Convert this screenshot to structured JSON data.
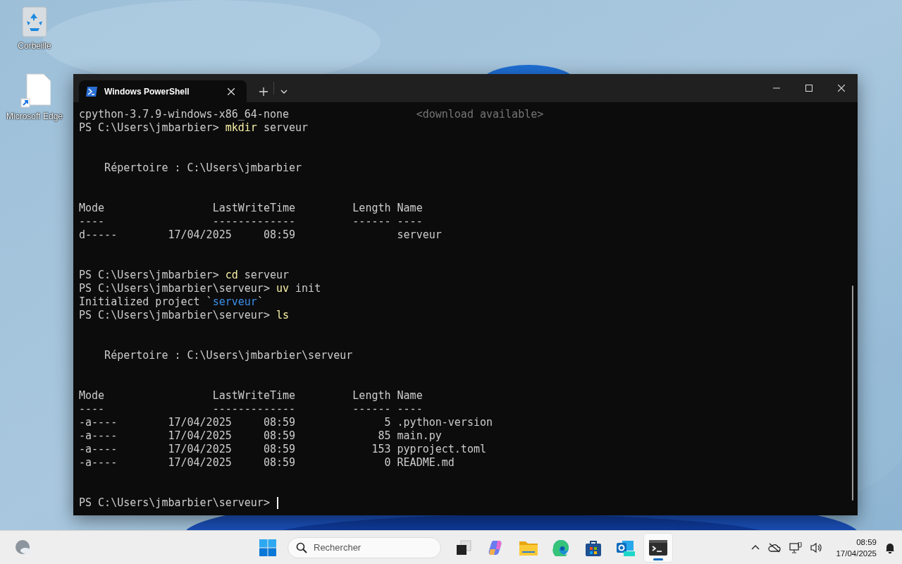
{
  "desktop": {
    "icons": [
      {
        "kind": "recycle",
        "label": "Corbeille"
      },
      {
        "kind": "shortcut",
        "label": "Microsoft Edge"
      }
    ]
  },
  "window": {
    "tabs": [
      {
        "title": "Windows PowerShell",
        "selected": true
      }
    ],
    "lines": [
      {
        "kind": "text",
        "segments": [
          {
            "kind": "plain",
            "text": "cpython-3.7.9-windows-x86_64-none                    "
          },
          {
            "kind": "dim",
            "text": "<download available>"
          }
        ]
      },
      {
        "kind": "text",
        "segments": [
          {
            "kind": "plain",
            "text": "PS C:\\Users\\jmbarbier> "
          },
          {
            "kind": "command",
            "text": "mkdir"
          },
          {
            "kind": "plain",
            "text": " serveur"
          }
        ]
      },
      {
        "kind": "blank"
      },
      {
        "kind": "blank"
      },
      {
        "kind": "text",
        "segments": [
          {
            "kind": "plain",
            "text": "    Répertoire : C:\\Users\\jmbarbier"
          }
        ]
      },
      {
        "kind": "blank"
      },
      {
        "kind": "blank"
      },
      {
        "kind": "text",
        "segments": [
          {
            "kind": "plain",
            "text": "Mode                 LastWriteTime         Length Name"
          }
        ]
      },
      {
        "kind": "text",
        "segments": [
          {
            "kind": "plain",
            "text": "----                 -------------         ------ ----"
          }
        ]
      },
      {
        "kind": "text",
        "segments": [
          {
            "kind": "plain",
            "text": "d-----        17/04/2025     08:59                serveur"
          }
        ]
      },
      {
        "kind": "blank"
      },
      {
        "kind": "blank"
      },
      {
        "kind": "text",
        "segments": [
          {
            "kind": "plain",
            "text": "PS C:\\Users\\jmbarbier> "
          },
          {
            "kind": "command",
            "text": "cd"
          },
          {
            "kind": "plain",
            "text": " serveur"
          }
        ]
      },
      {
        "kind": "text",
        "segments": [
          {
            "kind": "plain",
            "text": "PS C:\\Users\\jmbarbier\\serveur> "
          },
          {
            "kind": "command",
            "text": "uv"
          },
          {
            "kind": "plain",
            "text": " init"
          }
        ]
      },
      {
        "kind": "text",
        "segments": [
          {
            "kind": "plain",
            "text": "Initialized project `"
          },
          {
            "kind": "accent",
            "text": "serveur"
          },
          {
            "kind": "plain",
            "text": "`"
          }
        ]
      },
      {
        "kind": "text",
        "segments": [
          {
            "kind": "plain",
            "text": "PS C:\\Users\\jmbarbier\\serveur> "
          },
          {
            "kind": "command",
            "text": "ls"
          }
        ]
      },
      {
        "kind": "blank"
      },
      {
        "kind": "blank"
      },
      {
        "kind": "text",
        "segments": [
          {
            "kind": "plain",
            "text": "    Répertoire : C:\\Users\\jmbarbier\\serveur"
          }
        ]
      },
      {
        "kind": "blank"
      },
      {
        "kind": "blank"
      },
      {
        "kind": "text",
        "segments": [
          {
            "kind": "plain",
            "text": "Mode                 LastWriteTime         Length Name"
          }
        ]
      },
      {
        "kind": "text",
        "segments": [
          {
            "kind": "plain",
            "text": "----                 -------------         ------ ----"
          }
        ]
      },
      {
        "kind": "text",
        "segments": [
          {
            "kind": "plain",
            "text": "-a----        17/04/2025     08:59              5 .python-version"
          }
        ]
      },
      {
        "kind": "text",
        "segments": [
          {
            "kind": "plain",
            "text": "-a----        17/04/2025     08:59             85 main.py"
          }
        ]
      },
      {
        "kind": "text",
        "segments": [
          {
            "kind": "plain",
            "text": "-a----        17/04/2025     08:59            153 pyproject.toml"
          }
        ]
      },
      {
        "kind": "text",
        "segments": [
          {
            "kind": "plain",
            "text": "-a----        17/04/2025     08:59              0 README.md"
          }
        ]
      },
      {
        "kind": "blank"
      },
      {
        "kind": "blank"
      },
      {
        "kind": "prompt",
        "segments": [
          {
            "kind": "plain",
            "text": "PS C:\\Users\\jmbarbier\\serveur> "
          }
        ]
      }
    ]
  },
  "taskbar": {
    "search": {
      "placeholder": "Rechercher"
    },
    "apps": [
      {
        "kind": "taskview",
        "selected": false
      },
      {
        "kind": "copilot",
        "selected": false
      },
      {
        "kind": "folder",
        "selected": false
      },
      {
        "kind": "edge",
        "selected": false
      },
      {
        "kind": "store",
        "selected": false
      },
      {
        "kind": "outlook",
        "selected": false
      },
      {
        "kind": "terminal",
        "selected": true
      }
    ],
    "time": "08:59",
    "date": "17/04/2025"
  }
}
